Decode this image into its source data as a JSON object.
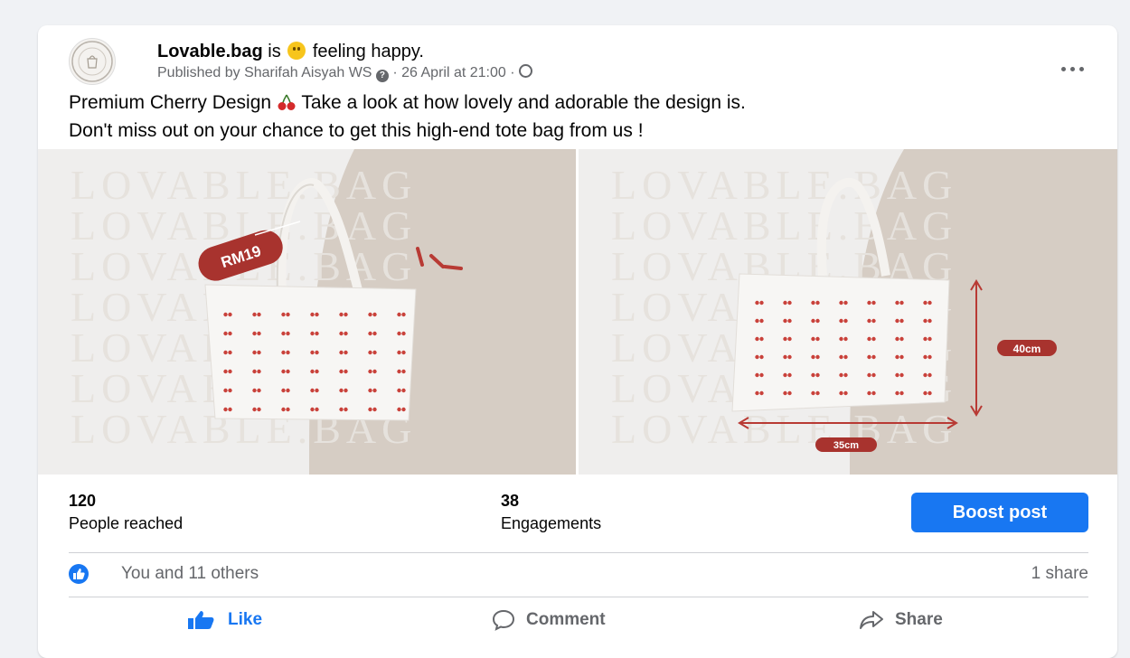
{
  "post": {
    "page_name": "Lovable.bag",
    "is_text": "is",
    "feeling_text": "feeling happy.",
    "published_text": "Published by Sharifah Aisyah WS",
    "date_text": "· 26 April at 21:00 ·",
    "caption_part1": "Premium Cherry Design",
    "caption_part2": "Take a look at how lovely and adorable the design is.",
    "caption_line2": "Don't miss out on your chance to get this high-end tote bag from us !",
    "avatar_text": "LOVABLE BAG",
    "photo_watermark": "LOVABLE.BAG",
    "price_tag": "RM19",
    "dim_height": "40cm",
    "dim_width": "35cm"
  },
  "stats": {
    "reached_value": "120",
    "reached_label": "People reached",
    "engagement_value": "38",
    "engagement_label": "Engagements",
    "boost_label": "Boost post"
  },
  "reactions": {
    "text": "You and 11 others",
    "shares": "1 share"
  },
  "actions": {
    "like": "Like",
    "comment": "Comment",
    "share": "Share"
  },
  "colors": {
    "accent": "#1877f2",
    "cherry": "#b83a34",
    "photo_beige": "#d6cdc4"
  }
}
